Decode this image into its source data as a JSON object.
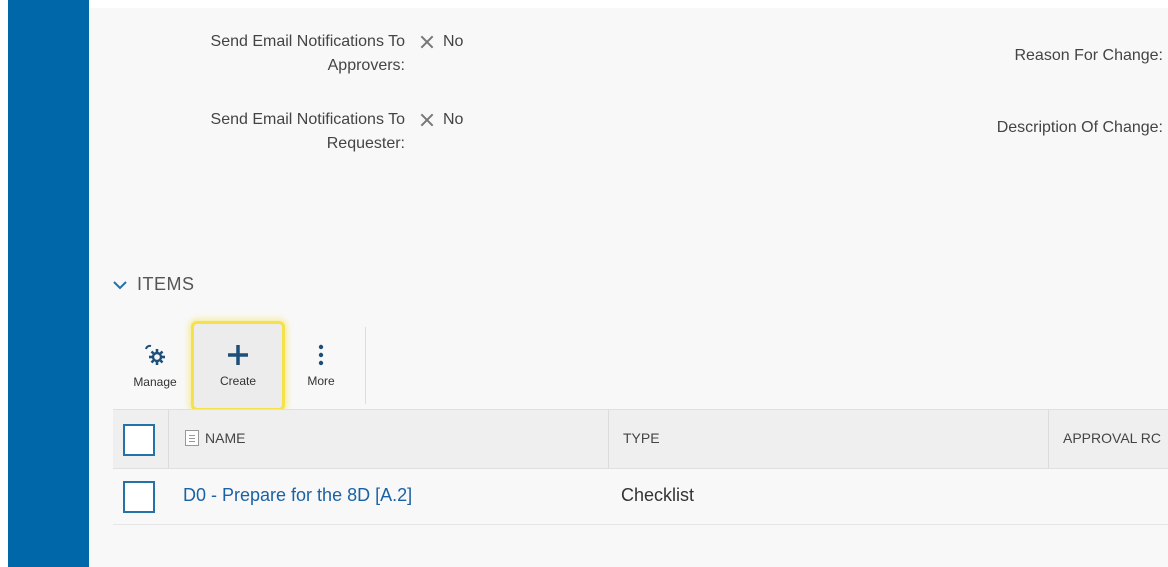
{
  "fields": {
    "email_approvers": {
      "label_line1": "Send Email Notifications To",
      "label_line2": "Approvers:",
      "value": "No"
    },
    "email_requester": {
      "label_line1": "Send Email Notifications To",
      "label_line2": "Requester:",
      "value": "No"
    },
    "reason_label": "Reason For Change:",
    "description_label": "Description Of Change:"
  },
  "items_section": {
    "title": "ITEMS",
    "toolbar": {
      "manage_label": "Manage",
      "create_label": "Create",
      "more_label": "More"
    },
    "columns": [
      "NAME",
      "TYPE",
      "APPROVAL RC"
    ],
    "rows": [
      {
        "name": "D0 - Prepare for the 8D [A.2]",
        "type": "Checklist",
        "approval": ""
      }
    ]
  },
  "colors": {
    "sidebar": "#0068a8",
    "link": "#1a62a6",
    "highlight": "#f5e24a",
    "checkbox_border": "#2372a8"
  }
}
